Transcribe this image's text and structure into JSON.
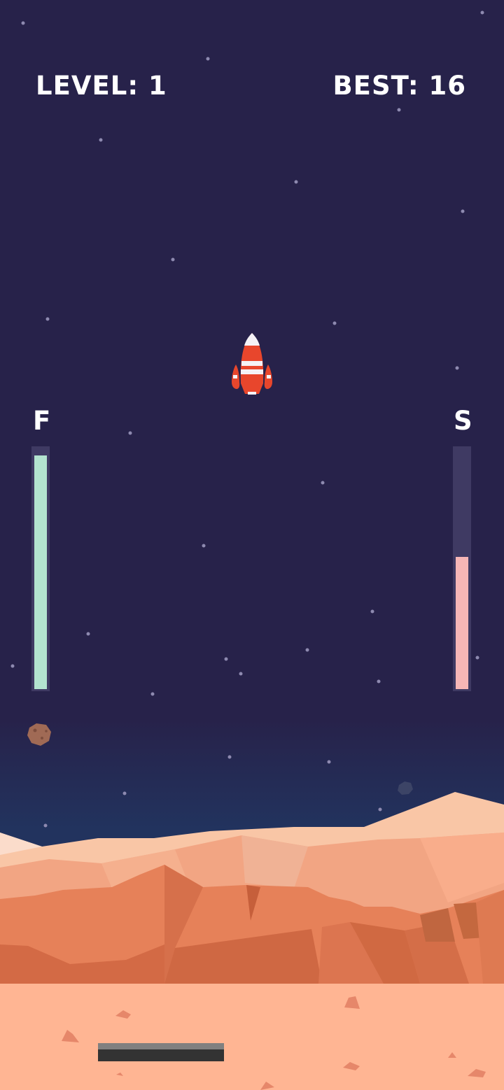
{
  "hud": {
    "level_label": "LEVEL: 1",
    "best_label": "BEST: 16"
  },
  "gauges": {
    "fuel": {
      "label": "F",
      "level": 0.97,
      "color": "#b3e3cf"
    },
    "speed": {
      "label": "S",
      "level": 0.55,
      "color": "#f6b6b6"
    }
  },
  "colors": {
    "sky": "#27224a",
    "horizon": "#22335e",
    "ground": "#ffb593",
    "rocket_body": "#e8462c",
    "landing_pad": "#333333"
  }
}
